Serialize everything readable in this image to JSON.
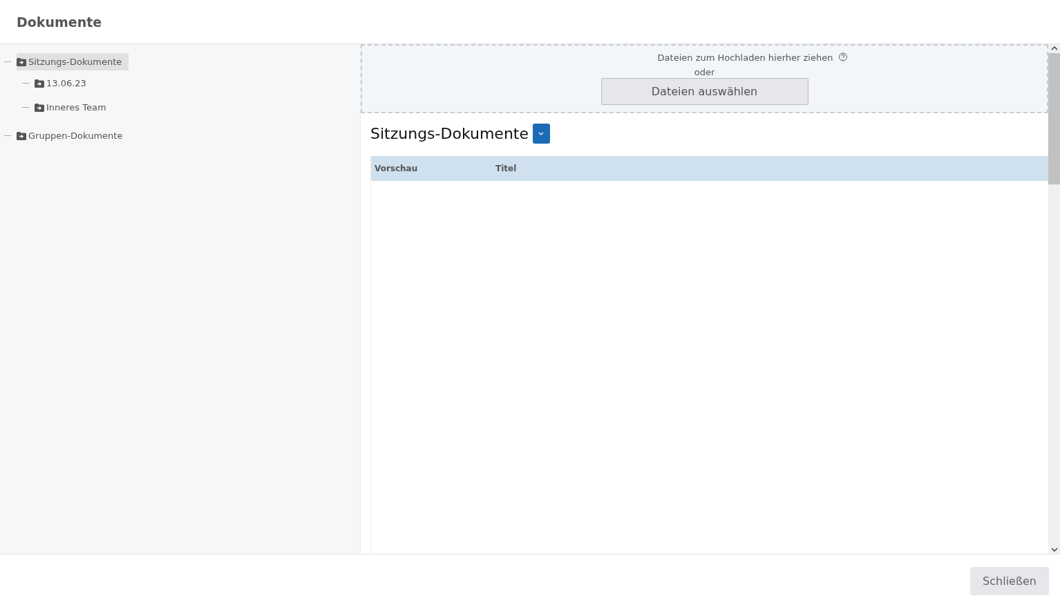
{
  "window": {
    "title": "Dokumente"
  },
  "tree": [
    {
      "label": "Sitzungs-Dokumente",
      "selected": true,
      "children": [
        {
          "label": "13.06.23",
          "selected": false
        },
        {
          "label": "Inneres Team",
          "selected": false
        }
      ]
    },
    {
      "label": "Gruppen-Dokumente",
      "selected": false
    }
  ],
  "upload": {
    "hint": "Dateien zum Hochladen hierher ziehen",
    "or": "oder",
    "button": "Dateien auswählen"
  },
  "folder_title": "Sitzungs-Dokumente",
  "table": {
    "columns": [
      "Vorschau",
      "Titel"
    ]
  },
  "buttons": [
    "Schließen"
  ]
}
